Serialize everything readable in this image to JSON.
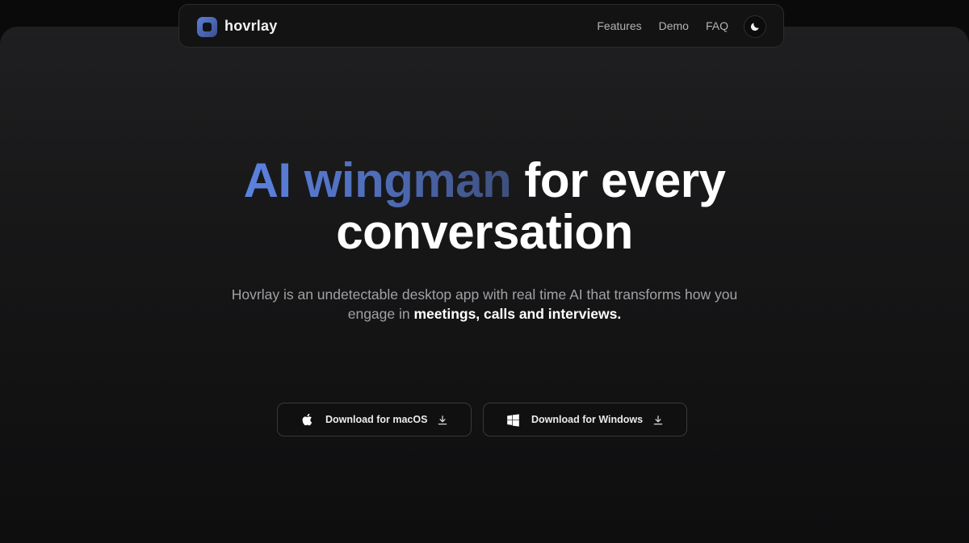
{
  "header": {
    "brand": "hovrlay",
    "nav": [
      {
        "label": "Features"
      },
      {
        "label": "Demo"
      },
      {
        "label": "FAQ"
      }
    ],
    "theme_toggle_icon": "moon-icon"
  },
  "hero": {
    "headline_accent": "AI wingman",
    "headline_rest": " for every",
    "headline_line2": "conversation",
    "subtitle_text": "Hovrlay is an undetectable desktop app with real time AI that transforms how you engage in ",
    "subtitle_bold": "meetings, calls and interviews."
  },
  "downloads": {
    "mac": {
      "label": "Download for macOS",
      "icon": "apple-icon",
      "trailing_icon": "download-icon"
    },
    "windows": {
      "label": "Download for Windows",
      "icon": "windows-icon",
      "trailing_icon": "download-icon"
    }
  },
  "colors": {
    "accent_start": "#5b82e0",
    "accent_end": "#3e4f7c",
    "background": "#0a0a0b"
  }
}
